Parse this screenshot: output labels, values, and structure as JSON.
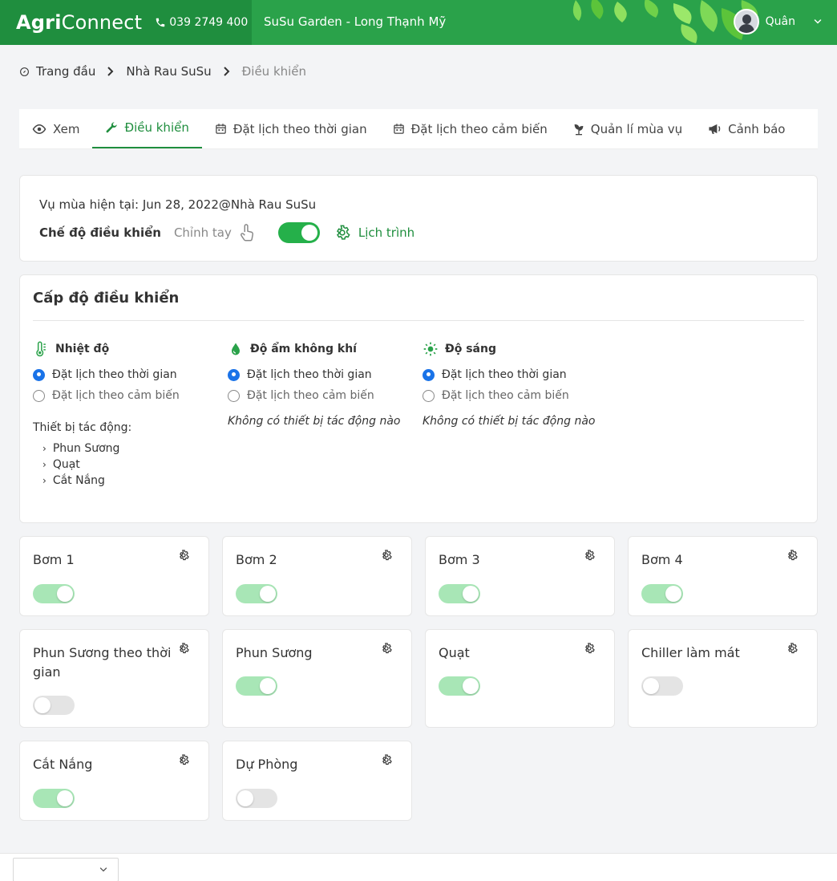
{
  "header": {
    "logo_bold": "Agri",
    "logo_light": "Connect",
    "phone": "039 2749 400",
    "farm": "SuSu Garden - Long Thạnh Mỹ",
    "user": "Quân"
  },
  "breadcrumb": {
    "home": "Trang đầu",
    "parent": "Nhà Rau SuSu",
    "current": "Điều khiển"
  },
  "tabs": [
    {
      "label": "Xem",
      "icon": "eye-icon"
    },
    {
      "label": "Điều khiển",
      "icon": "wrench-icon",
      "active": true
    },
    {
      "label": "Đặt lịch theo thời gian",
      "icon": "calendar-icon"
    },
    {
      "label": "Đặt lịch theo cảm biến",
      "icon": "calendar-icon"
    },
    {
      "label": "Quản lí mùa vụ",
      "icon": "sprout-icon"
    },
    {
      "label": "Cảnh báo",
      "icon": "megaphone-icon"
    }
  ],
  "season": {
    "text": "Vụ mùa hiện tại: Jun 28, 2022@Nhà Rau SuSu",
    "mode_label": "Chế độ điều khiển",
    "manual_label": "Chỉnh tay",
    "schedule_label": "Lịch trình",
    "mode_schedule_on": true
  },
  "levels": {
    "title": "Cấp độ điều khiển",
    "option_time": "Đặt lịch theo thời gian",
    "option_sensor": "Đặt lịch theo cảm biến",
    "affect_label": "Thiết bị tác động:",
    "no_device": "Không có thiết bị tác động nào",
    "columns": [
      {
        "title": "Nhiệt độ",
        "icon": "thermometer-icon",
        "selected": "time",
        "devices": [
          "Phun Sương",
          "Quạt",
          "Cắt Nắng"
        ]
      },
      {
        "title": "Độ ẩm không khí",
        "icon": "water-drop-icon",
        "selected": "time",
        "devices": []
      },
      {
        "title": "Độ sáng",
        "icon": "sun-icon",
        "selected": "time",
        "devices": []
      }
    ]
  },
  "devices": [
    {
      "name": "Bơm 1",
      "on": true
    },
    {
      "name": "Bơm 2",
      "on": true
    },
    {
      "name": "Bơm 3",
      "on": true
    },
    {
      "name": "Bơm 4",
      "on": true
    },
    {
      "name": "Phun Sương theo thời gian",
      "on": false
    },
    {
      "name": "Phun Sương",
      "on": true
    },
    {
      "name": "Quạt",
      "on": true
    },
    {
      "name": "Chiller làm mát",
      "on": false
    },
    {
      "name": "Cắt Nắng",
      "on": true
    },
    {
      "name": "Dự Phòng",
      "on": false
    }
  ],
  "colors": {
    "header_green": "#2aa24a",
    "brand_green": "#1f8e3e",
    "toggle_on": "#a8e6b6",
    "radio_blue": "#1a73e8"
  }
}
